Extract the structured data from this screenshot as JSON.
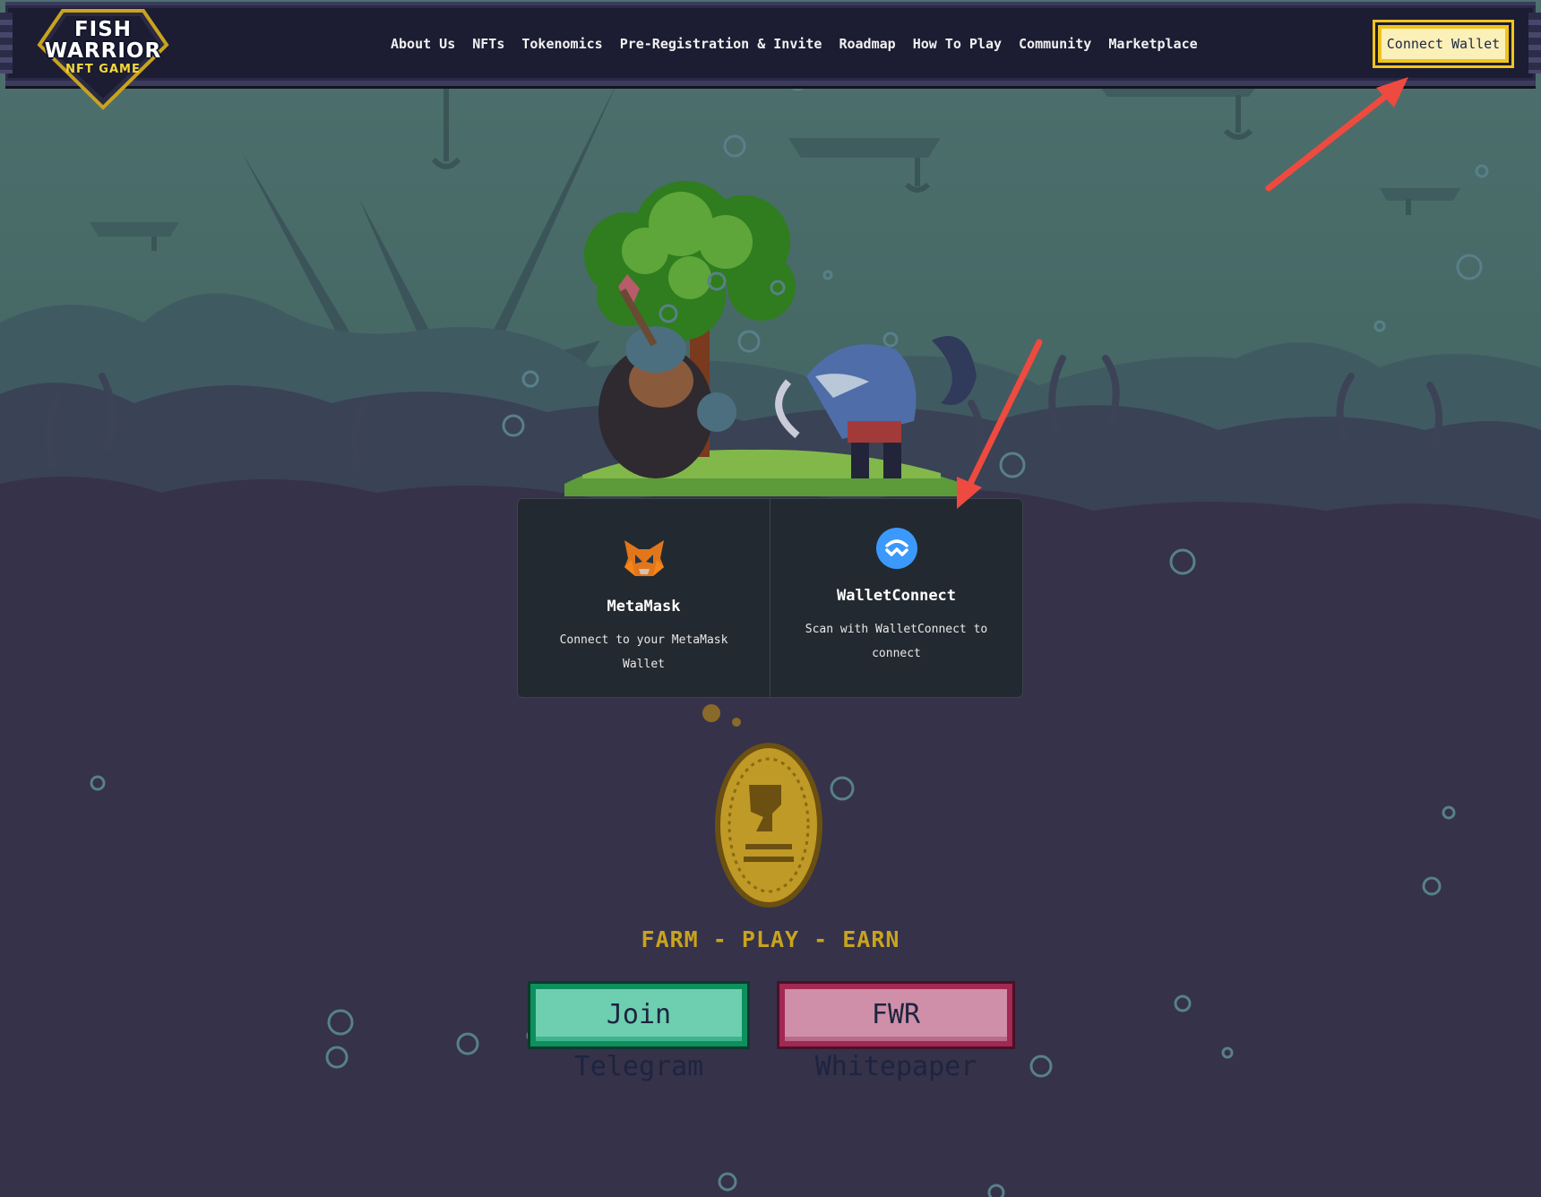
{
  "brand": {
    "logo_line1": "FISH",
    "logo_line2": "WARRIOR",
    "logo_sub": "NFT GAME"
  },
  "nav": {
    "items": [
      {
        "label": "About Us"
      },
      {
        "label": "NFTs"
      },
      {
        "label": "Tokenomics"
      },
      {
        "label": "Pre-Registration & Invite"
      },
      {
        "label": "Roadmap"
      },
      {
        "label": "How To Play"
      },
      {
        "label": "Community"
      },
      {
        "label": "Marketplace"
      }
    ]
  },
  "header": {
    "connect_label": "Connect Wallet"
  },
  "wallet_modal": {
    "options": [
      {
        "name": "MetaMask",
        "description": "Connect to your MetaMask Wallet",
        "icon": "metamask-fox-icon"
      },
      {
        "name": "WalletConnect",
        "description": "Scan with WalletConnect to connect",
        "icon": "walletconnect-icon"
      }
    ]
  },
  "hero": {
    "tagline": "FARM - PLAY - EARN",
    "telegram_label": "Join Telegram",
    "whitepaper_label": "FWR Whitepaper"
  },
  "colors": {
    "page_bg": "#34304a",
    "header_bg": "#1c1c32",
    "connect_bg": "#fbf0b8",
    "accent_gold": "#c9a31e",
    "telegram_green": "#6dcfb0",
    "whitepaper_pink": "#cf8fa8",
    "annotation_arrow": "#ee4a3f"
  }
}
